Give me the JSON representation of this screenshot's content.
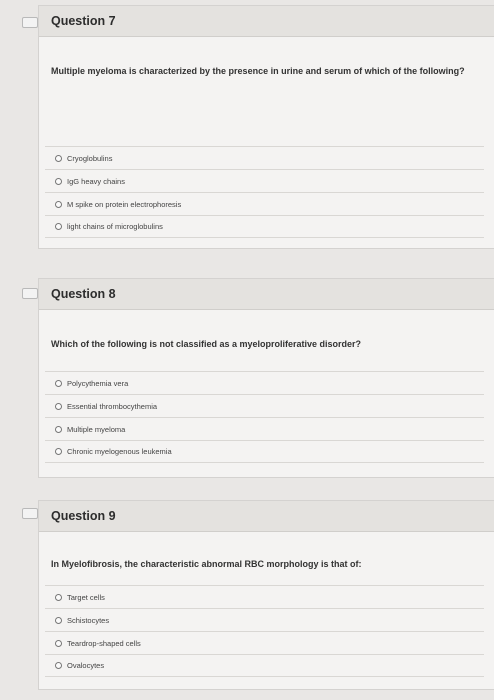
{
  "questions": [
    {
      "title": "Question 7",
      "text": "Multiple myeloma is characterized by the presence in urine and serum of which of the following?",
      "options": [
        "Cryoglobulins",
        "IgG heavy chains",
        "M spike on protein electrophoresis",
        "light chains of microglobulins"
      ]
    },
    {
      "title": "Question 8",
      "text": "Which of the following is not classified as a myeloproliferative disorder?",
      "options": [
        "Polycythemia vera",
        "Essential thrombocythemia",
        "Multiple myeloma",
        "Chronic myelogenous leukemia"
      ]
    },
    {
      "title": "Question 9",
      "text": "In Myelofibrosis, the characteristic abnormal RBC morphology is that of:",
      "options": [
        "Target cells",
        "Schistocytes",
        "Teardrop-shaped cells",
        "Ovalocytes"
      ]
    }
  ]
}
